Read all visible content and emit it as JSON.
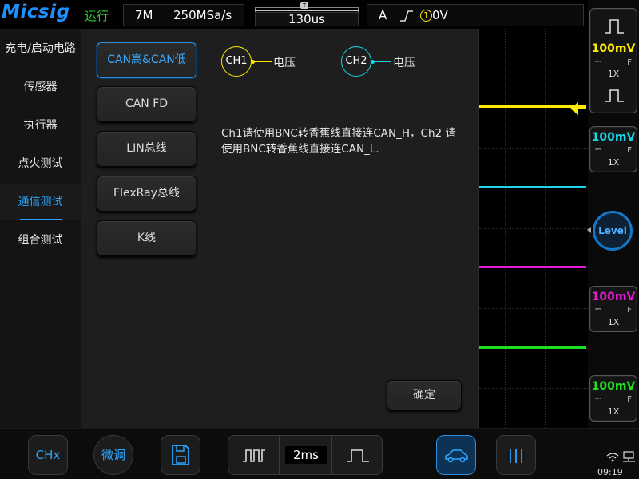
{
  "topbar": {
    "logo": "Micsig",
    "run_status": "运行",
    "memory_depth": "7M",
    "sample_rate": "250MSa/s",
    "timebase": "130us",
    "trigger_source": "A",
    "trigger_channel": "1",
    "trigger_level": "0V"
  },
  "sidebar": {
    "items": [
      {
        "label": "充电/启动电路"
      },
      {
        "label": "传感器"
      },
      {
        "label": "执行器"
      },
      {
        "label": "点火测试"
      },
      {
        "label": "通信测试",
        "active": true
      },
      {
        "label": "组合测试"
      }
    ]
  },
  "protocols": [
    {
      "label": "CAN高&CAN低",
      "active": true
    },
    {
      "label": "CAN FD"
    },
    {
      "label": "LIN总线"
    },
    {
      "label": "FlexRay总线"
    },
    {
      "label": "K线"
    }
  ],
  "probes": [
    {
      "channel": "CH1",
      "label": "电压",
      "color": "#ffeb00"
    },
    {
      "channel": "CH2",
      "label": "电压",
      "color": "#19d4e6"
    }
  ],
  "instruction": "Ch1请使用BNC转香蕉线直接连CAN_H，Ch2 请使用BNC转香蕉线直接连CAN_L.",
  "confirm_label": "确定",
  "channels": [
    {
      "scale": "100mV",
      "coupling": "⎓",
      "bandwidth": "F",
      "probe": "1X",
      "color": "#ffeb00"
    },
    {
      "scale": "100mV",
      "coupling": "⎓",
      "bandwidth": "F",
      "probe": "1X",
      "color": "#19d4e6"
    },
    {
      "scale": "100mV",
      "coupling": "⎓",
      "bandwidth": "F",
      "probe": "1X",
      "color": "#e619d4"
    },
    {
      "scale": "100mV",
      "coupling": "⎓",
      "bandwidth": "F",
      "probe": "1X",
      "color": "#1fe01f"
    }
  ],
  "level_label": "Level",
  "bottombar": {
    "chx_label": "CHx",
    "fine_label": "微调",
    "timebase_readout": "2ms",
    "clock": "09:19"
  },
  "colors": {
    "accent": "#2aa6ff",
    "ch1": "#ffeb00",
    "ch2": "#19d4e6",
    "ch3": "#e619d4",
    "ch4": "#1fe01f"
  },
  "icons": {
    "save": "save-icon",
    "pulse_wide": "pulse-train-icon",
    "pulse_narrow": "single-pulse-icon",
    "auto_mode": "car-icon",
    "cursor": "vertical-bars-icon",
    "wifi": "wifi-icon",
    "network": "network-icon"
  }
}
